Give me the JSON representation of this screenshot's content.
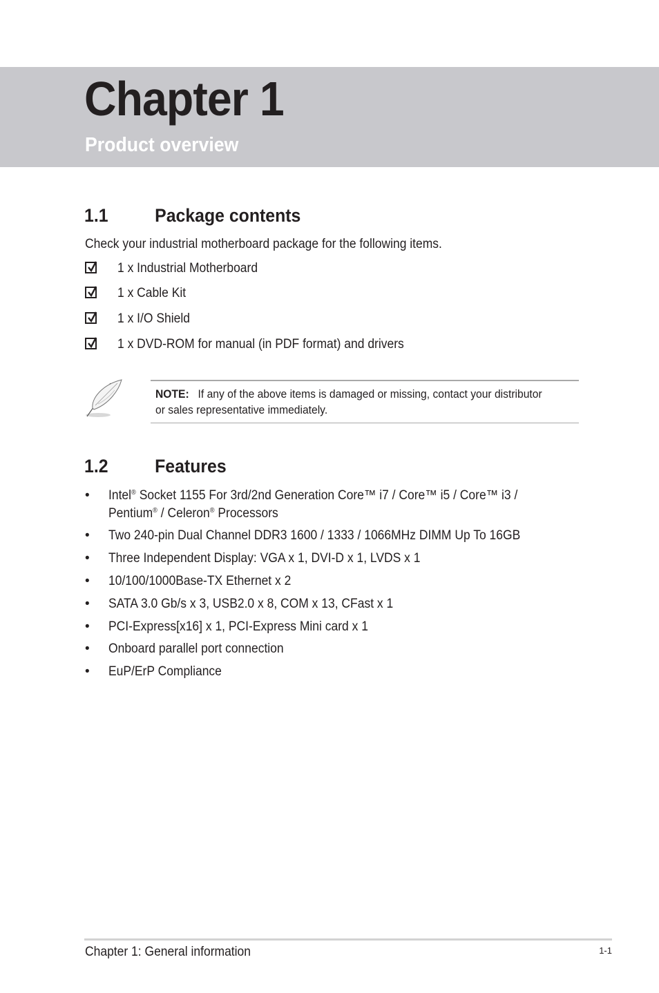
{
  "header": {
    "chapter_title": "Chapter 1",
    "chapter_subtitle": "Product overview",
    "banner_color": "#c8c8cc"
  },
  "section_1": {
    "number": "1.1",
    "title": "Package contents",
    "intro": "Check your industrial motherboard package for the following items.",
    "items": [
      {
        "icon": "checkbox-checked-icon",
        "text": "1 x Industrial Motherboard"
      },
      {
        "icon": "checkbox-checked-icon",
        "text": "1 x Cable Kit"
      },
      {
        "icon": "checkbox-checked-icon",
        "text": "1 x I/O Shield"
      },
      {
        "icon": "checkbox-checked-icon",
        "text": "1 x DVD-ROM for manual (in PDF format) and drivers"
      }
    ],
    "note": {
      "icon": "quill-pen-icon",
      "label": "NOTE:",
      "text": "If any of the above items is damaged or missing, contact your distributor or sales representative immediately."
    }
  },
  "section_2": {
    "number": "1.2",
    "title": "Features",
    "bullet": "•",
    "features": [
      {
        "parts": [
          "Intel",
          "®",
          " Socket 1155 For 3rd/2nd Generation Core™ i7 / Core™ i5 / Core™ i3 /"
        ],
        "line2": [
          "Pentium",
          "®",
          " / Celeron",
          "®",
          " Processors"
        ]
      },
      {
        "text": "Two 240-pin Dual Channel DDR3 1600 / 1333 / 1066MHz DIMM Up To 16GB"
      },
      {
        "text": "Three Independent Display: VGA x 1, DVI-D x 1, LVDS x 1"
      },
      {
        "text": "10/100/1000Base-TX Ethernet x 2"
      },
      {
        "text": "SATA 3.0 Gb/s x 3, USB2.0 x 8, COM x 13, CFast x 1"
      },
      {
        "text": "PCI-Express[x16] x 1, PCI-Express Mini card x 1"
      },
      {
        "text": "Onboard parallel port connection"
      },
      {
        "text": "EuP/ErP Compliance"
      }
    ]
  },
  "footer": {
    "left": "Chapter 1: General information",
    "page_number": "1-1"
  }
}
